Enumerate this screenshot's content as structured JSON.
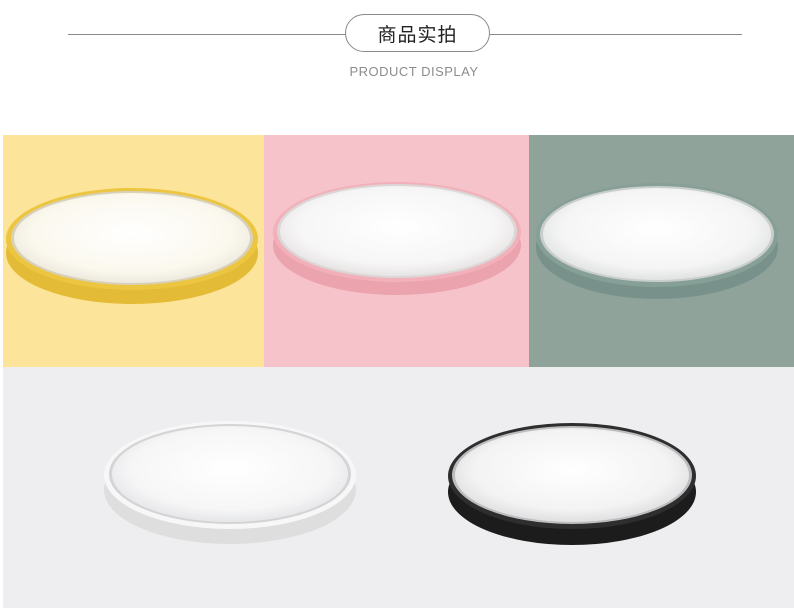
{
  "header": {
    "title": "商品实拍",
    "subtitle": "PRODUCT DISPLAY"
  },
  "colors": {
    "yellow_bg": "#fce49a",
    "yellow_rim": "#e9c33b",
    "pink_bg": "#f7c3cb",
    "pink_rim": "#f0a5b0",
    "sage_bg": "#8fa39a",
    "sage_rim": "#7e978d",
    "bottom_bg": "#eeeef0",
    "white_rim": "#f4f4f4",
    "black_rim": "#2a2a2a"
  },
  "products": [
    {
      "name": "yellow-ceiling-lamp"
    },
    {
      "name": "pink-ceiling-lamp"
    },
    {
      "name": "sage-ceiling-lamp"
    },
    {
      "name": "white-ceiling-lamp"
    },
    {
      "name": "black-ceiling-lamp"
    }
  ]
}
